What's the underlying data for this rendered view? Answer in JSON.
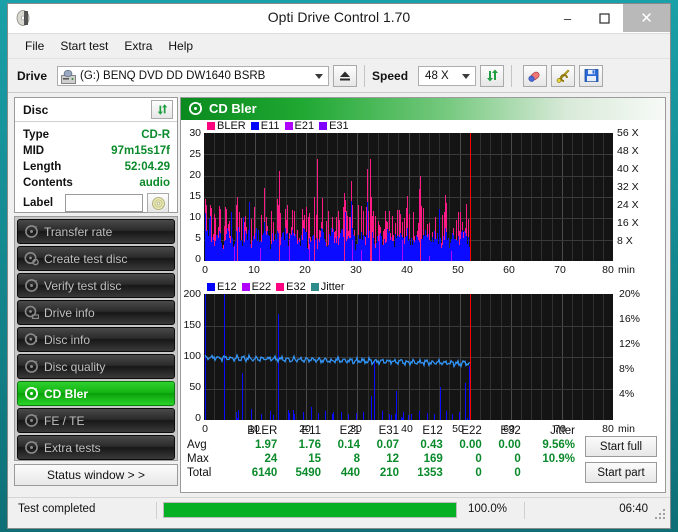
{
  "window": {
    "title": "Opti Drive Control 1.70",
    "app_icon": "disc-icon",
    "minimize": "–",
    "maximize": "❐",
    "close": "✕"
  },
  "menu": {
    "items": [
      "File",
      "Start test",
      "Extra",
      "Help"
    ]
  },
  "toolbar": {
    "drive_label": "Drive",
    "drive_value": "(G:)   BENQ DVD DD DW1640 BSRB",
    "eject_icon": "eject-icon",
    "speed_label": "Speed",
    "speed_value": "48 X",
    "refresh_icon": "refresh-icon",
    "eraser_icon": "eraser-icon",
    "tools_icon": "tools-icon",
    "save_icon": "save-icon"
  },
  "disc": {
    "header": "Disc",
    "refresh_icon": "refresh-icon",
    "rows": [
      {
        "key": "Type",
        "value": "CD-R"
      },
      {
        "key": "MID",
        "value": "97m15s17f"
      },
      {
        "key": "Length",
        "value": "52:04.29"
      },
      {
        "key": "Contents",
        "value": "audio"
      }
    ],
    "label_key": "Label",
    "label_value": "",
    "label_placeholder": "",
    "label_button_icon": "disc-icon"
  },
  "sidebar": {
    "items": [
      {
        "label": "Transfer rate",
        "icon": "disc-icon",
        "active": false
      },
      {
        "label": "Create test disc",
        "icon": "disc-write-icon",
        "active": false
      },
      {
        "label": "Verify test disc",
        "icon": "disc-check-icon",
        "active": false
      },
      {
        "label": "Drive info",
        "icon": "disc-drive-icon",
        "active": false
      },
      {
        "label": "Disc info",
        "icon": "disc-info-icon",
        "active": false
      },
      {
        "label": "Disc quality",
        "icon": "disc-quality-icon",
        "active": false
      },
      {
        "label": "CD Bler",
        "icon": "disc-bler-icon",
        "active": true
      },
      {
        "label": "FE / TE",
        "icon": "disc-fete-icon",
        "active": false
      },
      {
        "label": "Extra tests",
        "icon": "disc-extra-icon",
        "active": false
      }
    ],
    "status_window_button": "Status window > >"
  },
  "main": {
    "header_title": "CD Bler",
    "header_icon": "disc-bler-icon",
    "start_full": "Start full",
    "start_part": "Start part"
  },
  "stats": {
    "columns": [
      "BLER",
      "E11",
      "E21",
      "E31",
      "E12",
      "E22",
      "E32",
      "Jitter"
    ],
    "rows": [
      {
        "label": "Avg",
        "values": [
          "1.97",
          "1.76",
          "0.14",
          "0.07",
          "0.43",
          "0.00",
          "0.00",
          "9.56%"
        ]
      },
      {
        "label": "Max",
        "values": [
          "24",
          "15",
          "8",
          "12",
          "169",
          "0",
          "0",
          "10.9%"
        ]
      },
      {
        "label": "Total",
        "values": [
          "6140",
          "5490",
          "440",
          "210",
          "1353",
          "0",
          "0",
          ""
        ]
      }
    ]
  },
  "statusbar": {
    "message": "Test completed",
    "progress_percent": "100.0%",
    "progress_value": 100,
    "elapsed": "06:40"
  },
  "colors": {
    "bler": "#ff0080",
    "e11": "#0000ff",
    "e21": "#b000ff",
    "e31": "#8000ff",
    "e12": "#0000ff",
    "e22": "#b000ff",
    "e32": "#ff0080",
    "jitter": "#2e8b8b",
    "jitter_line": "#3399ff",
    "marker": "#ff0000",
    "accent_green": "#0aa00a",
    "progress_green": "#06b025"
  },
  "chart_data": [
    {
      "type": "bar",
      "title": "CD Bler",
      "xlabel": "min",
      "ylabel": "",
      "xlim": [
        0,
        80
      ],
      "ylim": [
        0,
        30
      ],
      "yticks": [
        0,
        5,
        10,
        15,
        20,
        25,
        30
      ],
      "xticks": [
        0,
        10,
        20,
        30,
        40,
        50,
        60,
        70,
        80
      ],
      "right_axis_label": "X",
      "right_ticks": [
        "8 X",
        "16 X",
        "24 X",
        "32 X",
        "40 X",
        "48 X",
        "56 X"
      ],
      "right_ylim": [
        0,
        56
      ],
      "grid": true,
      "legend": [
        {
          "name": "BLER",
          "color": "#ff0080"
        },
        {
          "name": "E11",
          "color": "#0000ff"
        },
        {
          "name": "E21",
          "color": "#b000ff"
        },
        {
          "name": "E31",
          "color": "#8000ff"
        }
      ],
      "data_end_min": 52.1,
      "marker_min": 52.1,
      "series": [
        {
          "name": "BLER",
          "color": "#ff0080",
          "x": [
            0.3,
            0.6,
            0.9,
            1.2,
            1.5,
            1.8,
            2.1,
            2.4,
            2.7,
            3.0,
            3.3,
            3.6,
            3.9,
            4.2,
            4.5,
            4.8,
            5.1,
            5.4,
            5.7,
            6.0,
            6.3,
            6.6,
            6.9,
            7.2,
            7.5,
            7.8,
            8.1,
            8.4,
            8.7,
            9.0,
            9.3,
            9.6,
            9.9,
            10.2,
            10.5,
            10.8,
            11.1,
            11.4,
            11.7,
            12.0,
            12.3,
            12.6,
            12.9,
            13.2,
            13.5,
            13.8,
            14.1,
            14.4,
            14.7,
            15.0,
            15.3,
            15.6,
            15.9,
            16.2,
            16.5,
            16.8,
            17.1,
            17.4,
            17.7,
            18.0,
            18.3,
            18.6,
            18.9,
            19.2,
            19.5,
            19.8,
            20.1,
            20.4,
            20.7,
            21.0,
            21.3,
            21.6,
            21.9,
            22.2,
            22.5,
            22.8,
            23.1,
            23.4,
            23.7,
            24.0,
            24.3,
            24.6,
            24.9,
            25.2,
            25.5,
            25.8,
            26.1,
            26.4,
            26.7,
            27.0,
            27.3,
            27.6,
            27.9,
            28.2,
            28.5,
            28.8,
            29.1,
            29.4,
            29.7,
            30.0,
            30.3,
            30.6,
            30.9,
            31.2,
            31.5,
            31.8,
            32.1,
            32.4,
            32.7,
            33.0,
            33.3,
            33.6,
            33.9,
            34.2,
            34.5,
            34.8,
            35.1,
            35.4,
            35.7,
            36.0,
            36.3,
            36.6,
            36.9,
            37.2,
            37.5,
            37.8,
            38.1,
            38.4,
            38.7,
            39.0,
            39.3,
            39.6,
            39.9,
            40.2,
            40.5,
            40.8,
            41.1,
            41.4,
            41.7,
            42.0,
            42.3,
            42.6,
            42.9,
            43.2,
            43.5,
            43.8,
            44.1,
            44.4,
            44.7,
            45.0,
            45.3,
            45.6,
            45.9,
            46.2,
            46.5,
            46.8,
            47.1,
            47.4,
            47.7,
            48.0,
            48.3,
            48.6,
            48.9,
            49.2,
            49.5,
            49.8,
            50.1,
            50.4,
            50.7,
            51.0,
            51.3,
            51.6,
            51.9
          ],
          "y": [
            5,
            7,
            11,
            4,
            9,
            6,
            12,
            5,
            8,
            4,
            10,
            6,
            12,
            7,
            5,
            9,
            15,
            6,
            11,
            4,
            13,
            7,
            5,
            10,
            8,
            6,
            12,
            5,
            9,
            14,
            6,
            8,
            11,
            5,
            10,
            4,
            7,
            3,
            5,
            2,
            4,
            3,
            6,
            4,
            21,
            18,
            12,
            9,
            13,
            7,
            10,
            15,
            6,
            12,
            5,
            9,
            11,
            4,
            8,
            3,
            7,
            10,
            6,
            12,
            5,
            8,
            13,
            4,
            9,
            6,
            11,
            7,
            14,
            5,
            10,
            8,
            12,
            6,
            9,
            4,
            7,
            11,
            5,
            13,
            8,
            6,
            10,
            4,
            9,
            7,
            16,
            5,
            11,
            8,
            6,
            12,
            4,
            9,
            7,
            10,
            5,
            8,
            13,
            6,
            24,
            11,
            9,
            15,
            7,
            12,
            5,
            10,
            8,
            6,
            11,
            4,
            9,
            7,
            13,
            5,
            10,
            8,
            12,
            6,
            9,
            14,
            7,
            5,
            11,
            8,
            6,
            10,
            4,
            9,
            12,
            7,
            20,
            6,
            11,
            8,
            5,
            9,
            13,
            7,
            10,
            6,
            12,
            4,
            8,
            11,
            5,
            9,
            7,
            13,
            6,
            10,
            8,
            5,
            12,
            9,
            7,
            11,
            6,
            14,
            8,
            10,
            5,
            13,
            7,
            9,
            6,
            11,
            8,
            12,
            5,
            10,
            7,
            9,
            6,
            8,
            11,
            7
          ]
        },
        {
          "name": "E11",
          "color": "#0000ff",
          "y_note": "blue filled envelope roughly 2-9, peaks to 15 at 21.5 and 32.5, 14 at 37.8"
        }
      ]
    },
    {
      "type": "bar",
      "title": "E12 / E22 / E32 / Jitter",
      "xlabel": "min",
      "xlim": [
        0,
        80
      ],
      "ylim": [
        0,
        200
      ],
      "yticks": [
        0,
        50,
        100,
        150,
        200
      ],
      "xticks": [
        0,
        10,
        20,
        30,
        40,
        50,
        60,
        70,
        80
      ],
      "right_ticks": [
        "4%",
        "8%",
        "12%",
        "16%",
        "20%"
      ],
      "right_ylim": [
        0,
        20
      ],
      "grid": true,
      "legend": [
        {
          "name": "E12",
          "color": "#0000ff"
        },
        {
          "name": "E22",
          "color": "#b000ff"
        },
        {
          "name": "E32",
          "color": "#ff0080"
        },
        {
          "name": "Jitter",
          "color": "#2e8b8b"
        }
      ],
      "data_end_min": 52.1,
      "marker_min": 52.1,
      "jitter_avg_percent": 9.56,
      "jitter_max_percent": 10.9,
      "series": [
        {
          "name": "E12",
          "color": "#0000ff",
          "x": [
            0.1,
            3.9,
            6.3,
            7.4,
            9.1,
            11.2,
            13.0,
            14.4,
            16.5,
            17.6,
            19.4,
            21.0,
            22.3,
            23.6,
            25.0,
            26.7,
            28.2,
            29.7,
            31.1,
            32.6,
            33.2,
            34.8,
            36.1,
            37.6,
            39.0,
            40.5,
            42.1,
            43.6,
            45.0,
            46.2,
            47.4,
            48.6,
            49.8,
            51.0,
            51.9
          ],
          "y": [
            200,
            200,
            12,
            74,
            18,
            10,
            14,
            169,
            16,
            9,
            12,
            20,
            11,
            14,
            10,
            12,
            9,
            11,
            13,
            38,
            93,
            15,
            10,
            46,
            12,
            9,
            14,
            11,
            10,
            52,
            14,
            9,
            12,
            58,
            85
          ]
        },
        {
          "name": "Jitter",
          "color": "#3399ff",
          "units": "percent",
          "approx_range": [
            8.8,
            10.9
          ],
          "note": "wavy line hovering around 9.5% (≈100 on left scale) across 0-52 min"
        }
      ]
    }
  ]
}
